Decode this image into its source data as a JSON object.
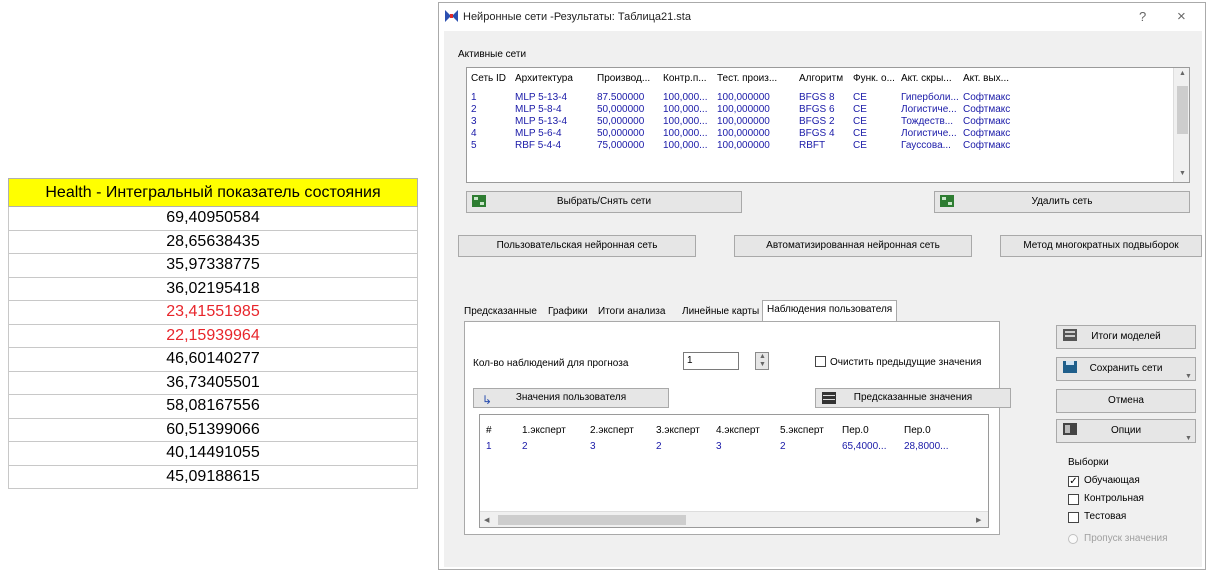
{
  "sheet": {
    "header": "Health - Интегральный показатель состояния",
    "values": [
      {
        "text": "69,40950584",
        "highlight": false
      },
      {
        "text": "28,65638435",
        "highlight": false
      },
      {
        "text": "35,97338775",
        "highlight": false
      },
      {
        "text": "36,02195418",
        "highlight": false
      },
      {
        "text": "23,41551985",
        "highlight": true
      },
      {
        "text": "22,15939964",
        "highlight": true
      },
      {
        "text": "46,60140277",
        "highlight": false
      },
      {
        "text": "36,73405501",
        "highlight": false
      },
      {
        "text": "58,08167556",
        "highlight": false
      },
      {
        "text": "60,51399066",
        "highlight": false
      },
      {
        "text": "40,14491055",
        "highlight": false
      },
      {
        "text": "45,09188615",
        "highlight": false
      }
    ],
    "colors": {
      "header_bg": "#ffff00",
      "highlight": "#e8252b"
    }
  },
  "window": {
    "title": "Нейронные сети -Результаты: Таблица21.sta",
    "help": "?",
    "close": "×"
  },
  "nets": {
    "group_label": "Активные сети",
    "columns": [
      "Сеть ID",
      "Архитектура",
      "Производ...",
      "Контр.п...",
      "Тест. произ...",
      "Алгоритм",
      "Функ. о...",
      "Акт. скры...",
      "Акт. вых..."
    ],
    "rows": [
      [
        "1",
        "MLP 5-13-4",
        "87.500000",
        "100,000...",
        "100,000000",
        "BFGS 8",
        "CE",
        "Гиперболи...",
        "Софтмакс"
      ],
      [
        "2",
        "MLP 5-8-4",
        "50,000000",
        "100,000...",
        "100,000000",
        "BFGS 6",
        "CE",
        "Логистиче...",
        "Софтмакс"
      ],
      [
        "3",
        "MLP 5-13-4",
        "50,000000",
        "100,000...",
        "100,000000",
        "BFGS 2",
        "CE",
        "Тождеств...",
        "Софтмакс"
      ],
      [
        "4",
        "MLP 5-6-4",
        "50,000000",
        "100,000...",
        "100,000000",
        "BFGS 4",
        "CE",
        "Логистиче...",
        "Софтмакс"
      ],
      [
        "5",
        "RBF 5-4-4",
        "75,000000",
        "100,000...",
        "100,000000",
        "RBFT",
        "CE",
        "Гауссова...",
        "Софтмакс"
      ]
    ],
    "select_button": "Выбрать/Снять сети",
    "delete_button": "Удалить сеть"
  },
  "actions": {
    "custom_net": "Пользовательская нейронная сеть",
    "auto_net": "Автоматизированная нейронная сеть",
    "multi_sampling": "Метод многократных подвыборок"
  },
  "tabs": [
    "Предсказанные",
    "Графики",
    "Итоги анализа",
    "Линейные карты",
    "Наблюдения пользователя"
  ],
  "custom_obs": {
    "count_label": "Кол-во наблюдений для прогноза",
    "count_value": "1",
    "clear_label": "Очистить предыдущие значения",
    "user_values_button": "Значения пользователя",
    "predicted_button": "Предсказанные значения",
    "columns": [
      "#",
      "1.эксперт",
      "2.эксперт",
      "3.эксперт",
      "4.эксперт",
      "5.эксперт",
      "Пер.0",
      "Пер.0"
    ],
    "rows": [
      [
        "1",
        "2",
        "3",
        "2",
        "3",
        "2",
        "65,4000...",
        "28,8000..."
      ]
    ]
  },
  "side": {
    "models_summary": "Итоги моделей",
    "save_networks": "Сохранить сети",
    "cancel": "Отмена",
    "options": "Опции",
    "samples_label": "Выборки",
    "samples": [
      {
        "label": "Обучающая",
        "checked": true
      },
      {
        "label": "Контрольная",
        "checked": false
      },
      {
        "label": "Тестовая",
        "checked": false
      }
    ],
    "missing_label": "Пропуск значения"
  }
}
